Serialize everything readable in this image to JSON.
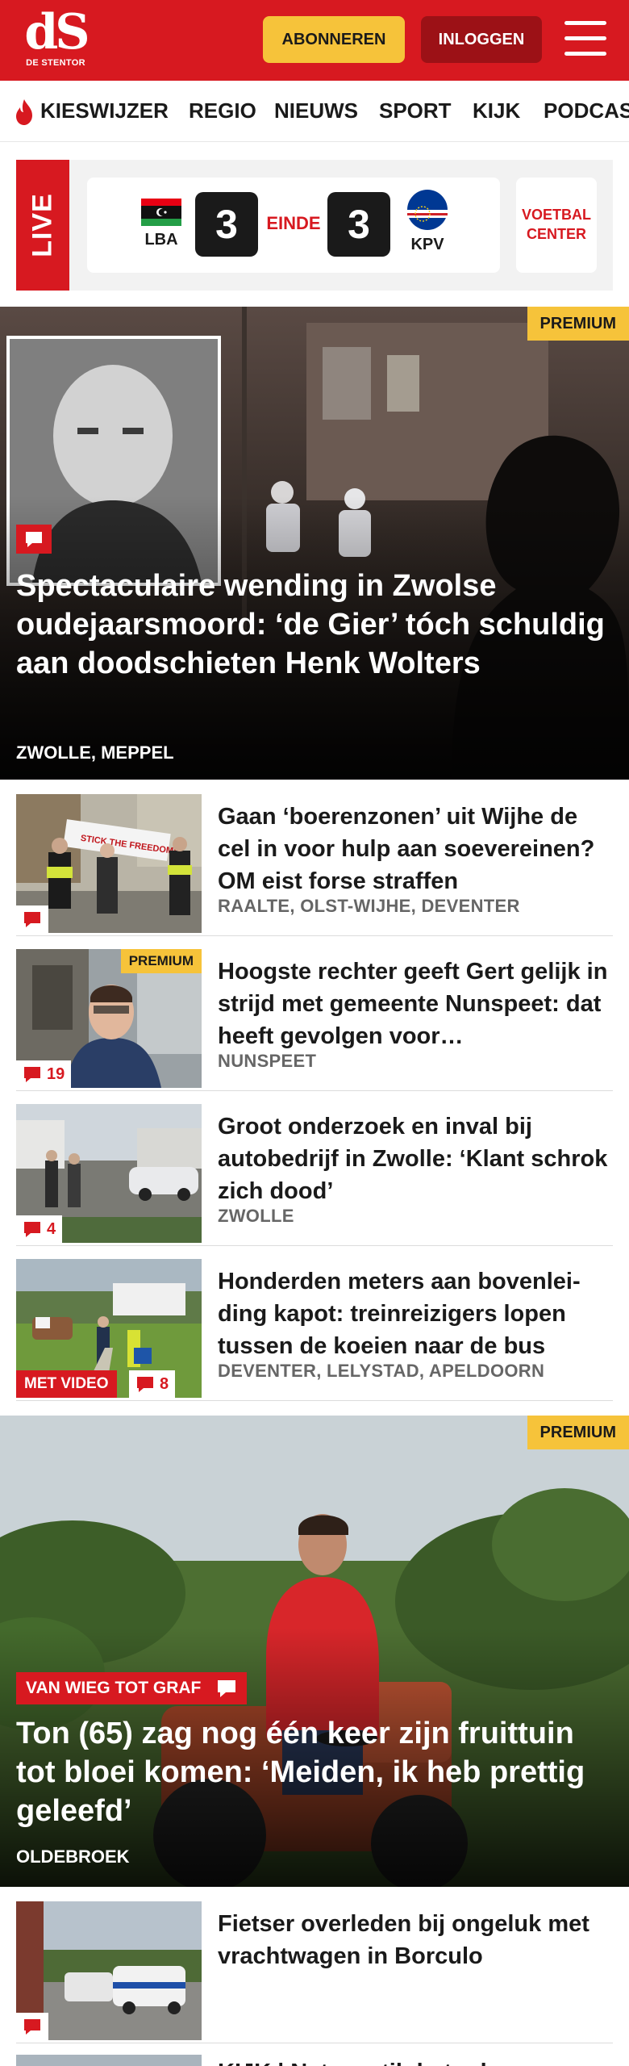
{
  "header": {
    "logo": {
      "mark": "dS",
      "name": "DE STENTOR"
    },
    "subscribe_label": "ABONNEREN",
    "login_label": "INLOGGEN",
    "menu_icon": "hamburger-menu-icon",
    "brand_color": "#d71920",
    "accent_color": "#f6c33a"
  },
  "nav": {
    "items": [
      "KIESWIJZER",
      "REGIO",
      "NIEUWS",
      "SPORT",
      "KIJK",
      "PODCAS"
    ],
    "first_icon": "flame-icon"
  },
  "live": {
    "label": "LIVE",
    "home_team": "LBA",
    "home_score": "3",
    "status": "EINDE",
    "away_team": "KPV",
    "away_score": "3",
    "center_button": [
      "VOETBAL",
      "CENTER"
    ]
  },
  "hero1": {
    "badge": "PREMIUM",
    "title": "Spectaculaire wending in Zwolse oudejaarsmoord: ‘de Gier’ tóch schuldig aan doodschieten Henk Wolters",
    "location": "ZWOLLE, MEPPEL",
    "comment_icon": "comment-icon"
  },
  "articles": [
    {
      "title": "Gaan ‘boerenzonen’ uit Wijhe de cel in voor hulp aan soevereinen? OM eist forse straffen",
      "location": "RAALTE, OLST-WIJHE, DEVENTER",
      "comments": "",
      "banner": "STICK THE FREEDOM!"
    },
    {
      "title": "Hoogste rechter geeft Gert gelijk in strijd met gemeente Nunspeet: dat heeft gevolgen voor…",
      "location": "NUNSPEET",
      "comments": "19",
      "premium": "PREMIUM"
    },
    {
      "title": "Groot onderzoek en inval bij autobedrijf in Zwolle: ‘Klant schrok zich dood’",
      "location": "ZWOLLE",
      "comments": "4"
    },
    {
      "title": "Honderden meters aan bovenlei­ding kapot: treinreizigers lopen tussen de koeien naar de bus",
      "location": "DEVENTER, LELYSTAD, APELDOORN",
      "comments": "8",
      "video": "MET VIDEO"
    }
  ],
  "hero2": {
    "badge": "PREMIUM",
    "rubric": "VAN WIEG TOT GRAF",
    "title": "Ton (65) zag nog één keer zijn fruittuin tot bloei komen: ‘Meiden, ik heb prettig geleefd’",
    "location": "OLDEBROEK"
  },
  "article5": {
    "title": "Fietser overleden bij ongeluk met vrachtwagen in Borculo",
    "comments": ""
  },
  "article6_partial": {
    "title": "KIJK | Nat en stil: het rak…"
  }
}
